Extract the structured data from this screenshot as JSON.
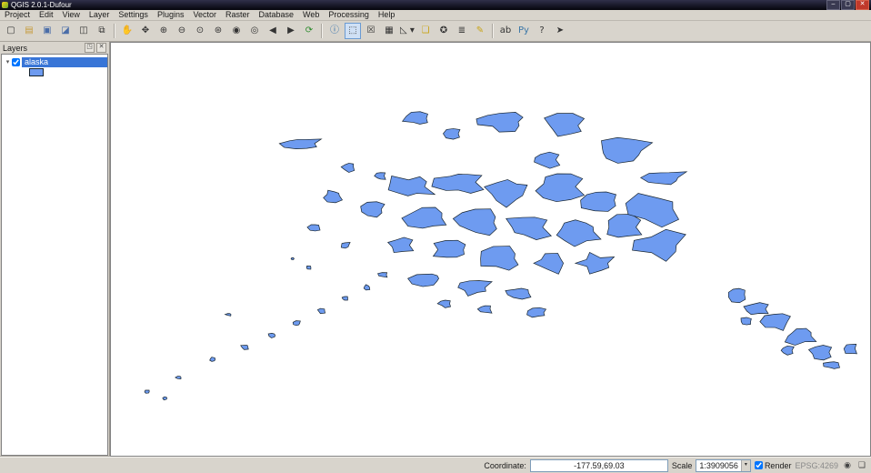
{
  "window": {
    "title": "QGIS 2.0.1-Dufour",
    "controls": {
      "minimize": "–",
      "maximize": "▢",
      "close": "✕"
    }
  },
  "menubar": {
    "items": [
      "Project",
      "Edit",
      "View",
      "Layer",
      "Settings",
      "Plugins",
      "Vector",
      "Raster",
      "Database",
      "Web",
      "Processing",
      "Help"
    ]
  },
  "toolbar": {
    "file_buttons": [
      {
        "name": "new-project-button",
        "glyph": "▢",
        "title": "New"
      },
      {
        "name": "open-project-button",
        "glyph": "▤",
        "title": "Open",
        "style": "color:#c69b3c"
      },
      {
        "name": "save-project-button",
        "glyph": "▣",
        "title": "Save",
        "style": "color:#4a6da8"
      },
      {
        "name": "save-project-as-button",
        "glyph": "◪",
        "title": "Save As",
        "style": "color:#4a6da8"
      },
      {
        "name": "new-print-composer-button",
        "glyph": "◫",
        "title": "New Print Composer"
      },
      {
        "name": "composer-manager-button",
        "glyph": "⧉",
        "title": "Composer Manager"
      }
    ],
    "nav_buttons": [
      {
        "name": "pan-map-button",
        "glyph": "✋",
        "title": "Pan Map"
      },
      {
        "name": "pan-to-selection-button",
        "glyph": "✥",
        "title": "Pan Map to Selection"
      },
      {
        "name": "zoom-in-button",
        "glyph": "⊕",
        "title": "Zoom In"
      },
      {
        "name": "zoom-out-button",
        "glyph": "⊖",
        "title": "Zoom Out"
      },
      {
        "name": "zoom-native-button",
        "glyph": "⊙",
        "title": "Zoom to Native Resolution"
      },
      {
        "name": "zoom-full-button",
        "glyph": "⊛",
        "title": "Zoom Full"
      },
      {
        "name": "zoom-to-selection-button",
        "glyph": "◉",
        "title": "Zoom to Selection"
      },
      {
        "name": "zoom-to-layer-button",
        "glyph": "◎",
        "title": "Zoom to Layer"
      },
      {
        "name": "zoom-last-button",
        "glyph": "◀",
        "title": "Zoom Last"
      },
      {
        "name": "zoom-next-button",
        "glyph": "▶",
        "title": "Zoom Next"
      },
      {
        "name": "refresh-button",
        "glyph": "⟳",
        "title": "Refresh",
        "style": "color:#2e8b2e"
      }
    ],
    "attr_buttons": [
      {
        "name": "identify-button",
        "glyph": "ⓘ",
        "title": "Identify Features",
        "style": "color:#2266aa"
      },
      {
        "name": "select-features-button",
        "glyph": "⬚ ▾",
        "title": "Select Features",
        "state": "active"
      },
      {
        "name": "deselect-button",
        "glyph": "☒",
        "title": "Deselect Features from All Layers"
      },
      {
        "name": "attribute-table-button",
        "glyph": "▦",
        "title": "Open Attribute Table"
      },
      {
        "name": "measure-button",
        "glyph": "◺ ▾",
        "title": "Measure Line"
      },
      {
        "name": "map-tips-button",
        "glyph": "❏",
        "title": "Map Tips",
        "style": "color:#c8a415"
      },
      {
        "name": "new-bookmark-button",
        "glyph": "✪",
        "title": "New Bookmark"
      },
      {
        "name": "show-bookmarks-button",
        "glyph": "≣",
        "title": "Show Bookmarks"
      },
      {
        "name": "annotation-button",
        "glyph": "✎",
        "title": "Text Annotation",
        "style": "color:#c8a415"
      }
    ],
    "extra_buttons": [
      {
        "name": "labeling-button",
        "glyph": "ab",
        "title": "Labeling"
      },
      {
        "name": "python-console-button",
        "glyph": "Py",
        "title": "Python Console",
        "style": "color:#3b77a8"
      },
      {
        "name": "whats-this-button",
        "glyph": "?",
        "title": "What's This?"
      },
      {
        "name": "pointer-button",
        "glyph": "➤",
        "title": "Pointer"
      }
    ]
  },
  "layers_panel": {
    "title": "Layers",
    "dock_glyph": "◳",
    "close_glyph": "✕",
    "layer": {
      "name": "alaska",
      "checked": true,
      "expander": "▾"
    }
  },
  "statusbar": {
    "coordinate_label": "Coordinate:",
    "coordinate_value": "-177.59,69.03",
    "scale_label": "Scale",
    "scale_value": "1:3909056",
    "combo_arrow": "▾",
    "render_label": "Render",
    "render_checked": true,
    "crs_label": "EPSG:4269",
    "crs_icon": "◉",
    "log_icon": "❏"
  },
  "map": {
    "background": "#ffffff",
    "fill": "#6e9bf0",
    "stroke": "#17242e"
  }
}
